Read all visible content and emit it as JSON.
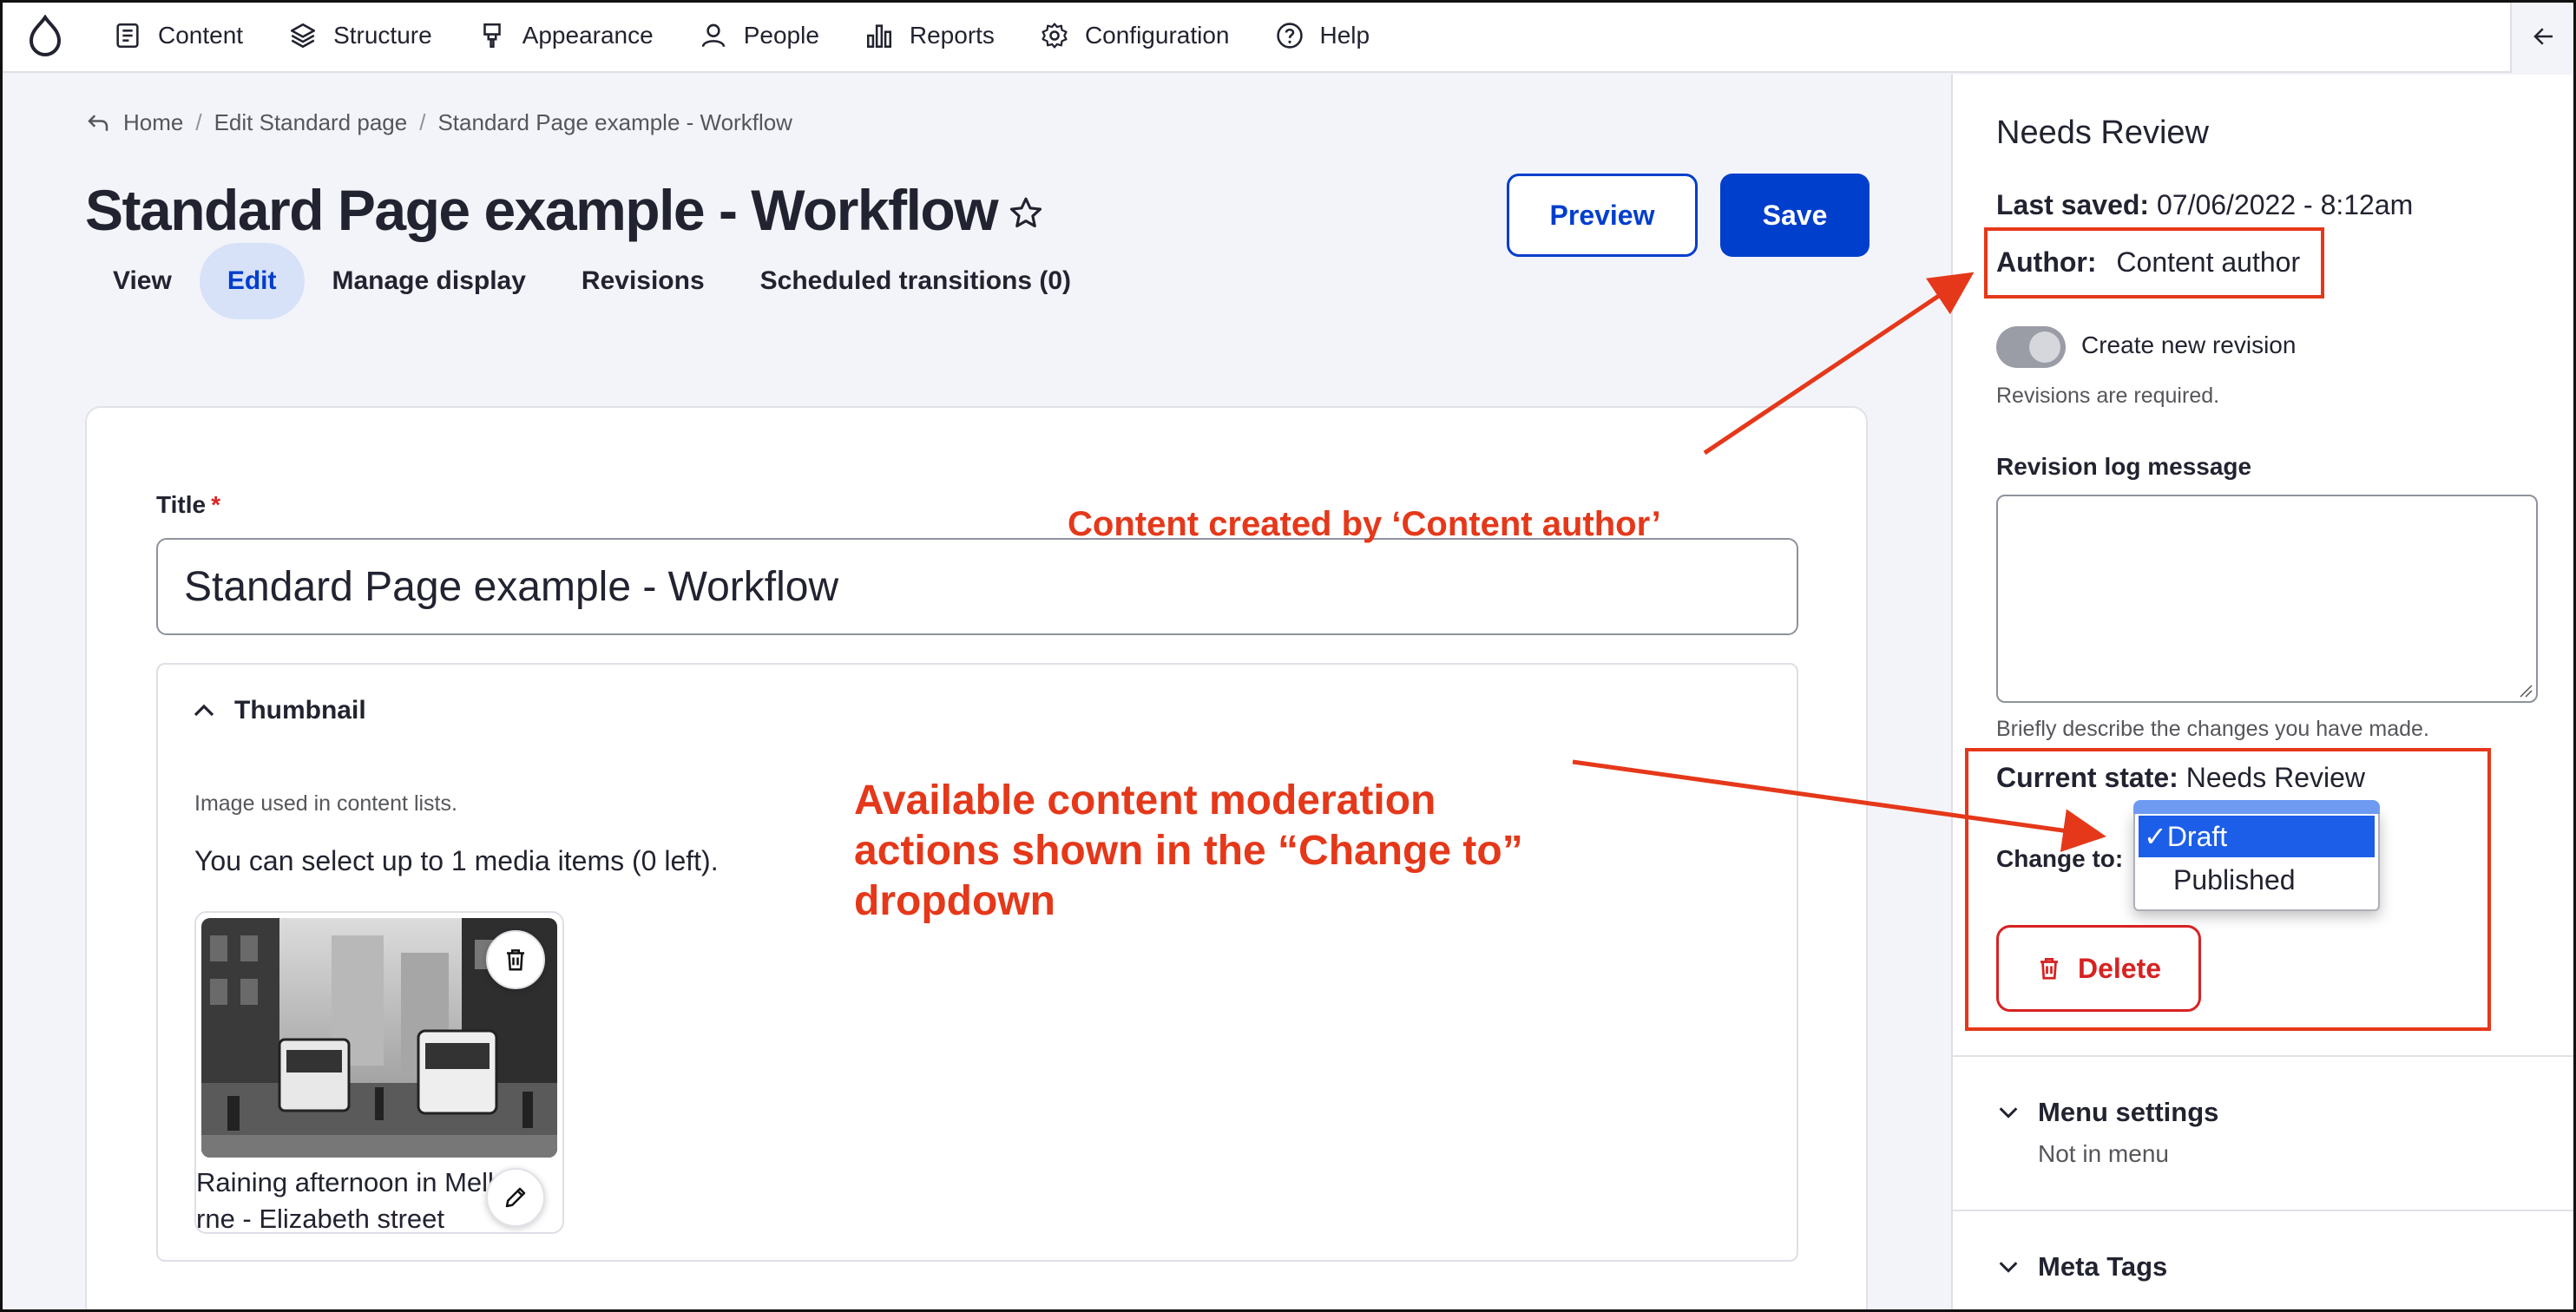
{
  "toolbar": {
    "items": [
      {
        "label": "Content",
        "icon": "document-icon"
      },
      {
        "label": "Structure",
        "icon": "layers-icon"
      },
      {
        "label": "Appearance",
        "icon": "brush-icon"
      },
      {
        "label": "People",
        "icon": "person-icon"
      },
      {
        "label": "Reports",
        "icon": "bar-chart-icon"
      },
      {
        "label": "Configuration",
        "icon": "gear-icon"
      },
      {
        "label": "Help",
        "icon": "help-icon"
      }
    ]
  },
  "breadcrumb": [
    "Home",
    "Edit Standard page",
    "Standard Page example - Workflow"
  ],
  "page": {
    "title": "Standard Page example - Workflow",
    "preview_label": "Preview",
    "save_label": "Save"
  },
  "tabs": [
    "View",
    "Edit",
    "Manage display",
    "Revisions",
    "Scheduled transitions (0)"
  ],
  "active_tab": "Edit",
  "form": {
    "title_label": "Title",
    "required_mark": "*",
    "title_value": "Standard Page example - Workflow",
    "thumbnail": {
      "summary": "Thumbnail",
      "description": "Image used in content lists.",
      "limit": "You can select up to 1 media items (0 left).",
      "caption_line1": "Raining afternoon in Melbou",
      "caption_line2": "rne - Elizabeth street"
    }
  },
  "annotations": {
    "author_note": "Content created by ‘Content author’",
    "dropdown_note_lines": [
      "Available content moderation",
      "actions shown in the “Change to”",
      "dropdown"
    ],
    "color": "#e5381a"
  },
  "sidebar": {
    "heading": "Needs Review",
    "last_saved_label": "Last saved:",
    "last_saved_value": "07/06/2022 - 8:12am",
    "author_label": "Author:",
    "author_value": "Content author",
    "revision_toggle_label": "Create new revision",
    "revision_hint": "Revisions are required.",
    "revision_log_label": "Revision log message",
    "revision_log_hint": "Briefly describe the changes you have made.",
    "current_state_label": "Current state:",
    "current_state_value": "Needs Review",
    "change_to_label": "Change to:",
    "change_to_options": [
      "Draft",
      "Published"
    ],
    "change_to_selected": "Draft",
    "checkmark": "✓",
    "delete_label": "Delete",
    "menu_settings_label": "Menu settings",
    "menu_settings_value": "Not in menu",
    "meta_tags_label": "Meta Tags"
  },
  "colors": {
    "primary": "#003ecc",
    "danger": "#d72222",
    "active_tab_bg": "#d7e2f8"
  }
}
